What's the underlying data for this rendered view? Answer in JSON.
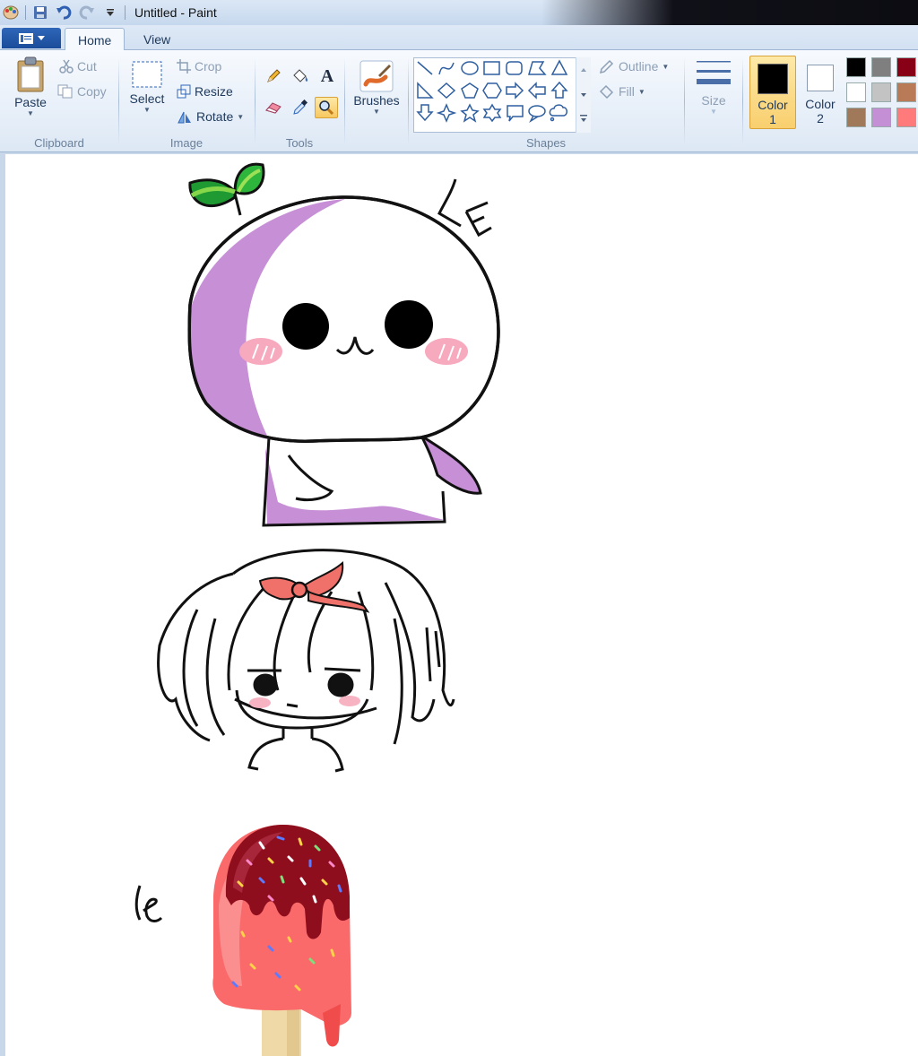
{
  "window": {
    "title": "Untitled - Paint"
  },
  "tabs": [
    {
      "label": "Home"
    },
    {
      "label": "View"
    }
  ],
  "clipboard": {
    "paste": "Paste",
    "cut": "Cut",
    "copy": "Copy",
    "group": "Clipboard"
  },
  "image": {
    "select": "Select",
    "crop": "Crop",
    "resize": "Resize",
    "rotate": "Rotate",
    "group": "Image"
  },
  "tools": {
    "group": "Tools",
    "text_glyph": "A"
  },
  "brushes": {
    "label": "Brushes"
  },
  "shapes": {
    "group": "Shapes",
    "outline": "Outline",
    "fill": "Fill"
  },
  "size": {
    "label": "Size"
  },
  "colors": {
    "color1_label": "Color",
    "color1_num": "1",
    "color2_label": "Color",
    "color2_num": "2",
    "color1": "#000000",
    "color2": "#ffffff",
    "palette": [
      "#000000",
      "#7f7f7f",
      "#880015",
      "#ffffff",
      "#c3c3c3",
      "#b97a57",
      "#a0785a",
      "#c58fd6",
      "#ff7b7b"
    ]
  },
  "canvas": {
    "signature_top": "LE",
    "signature_bottom": "le"
  }
}
